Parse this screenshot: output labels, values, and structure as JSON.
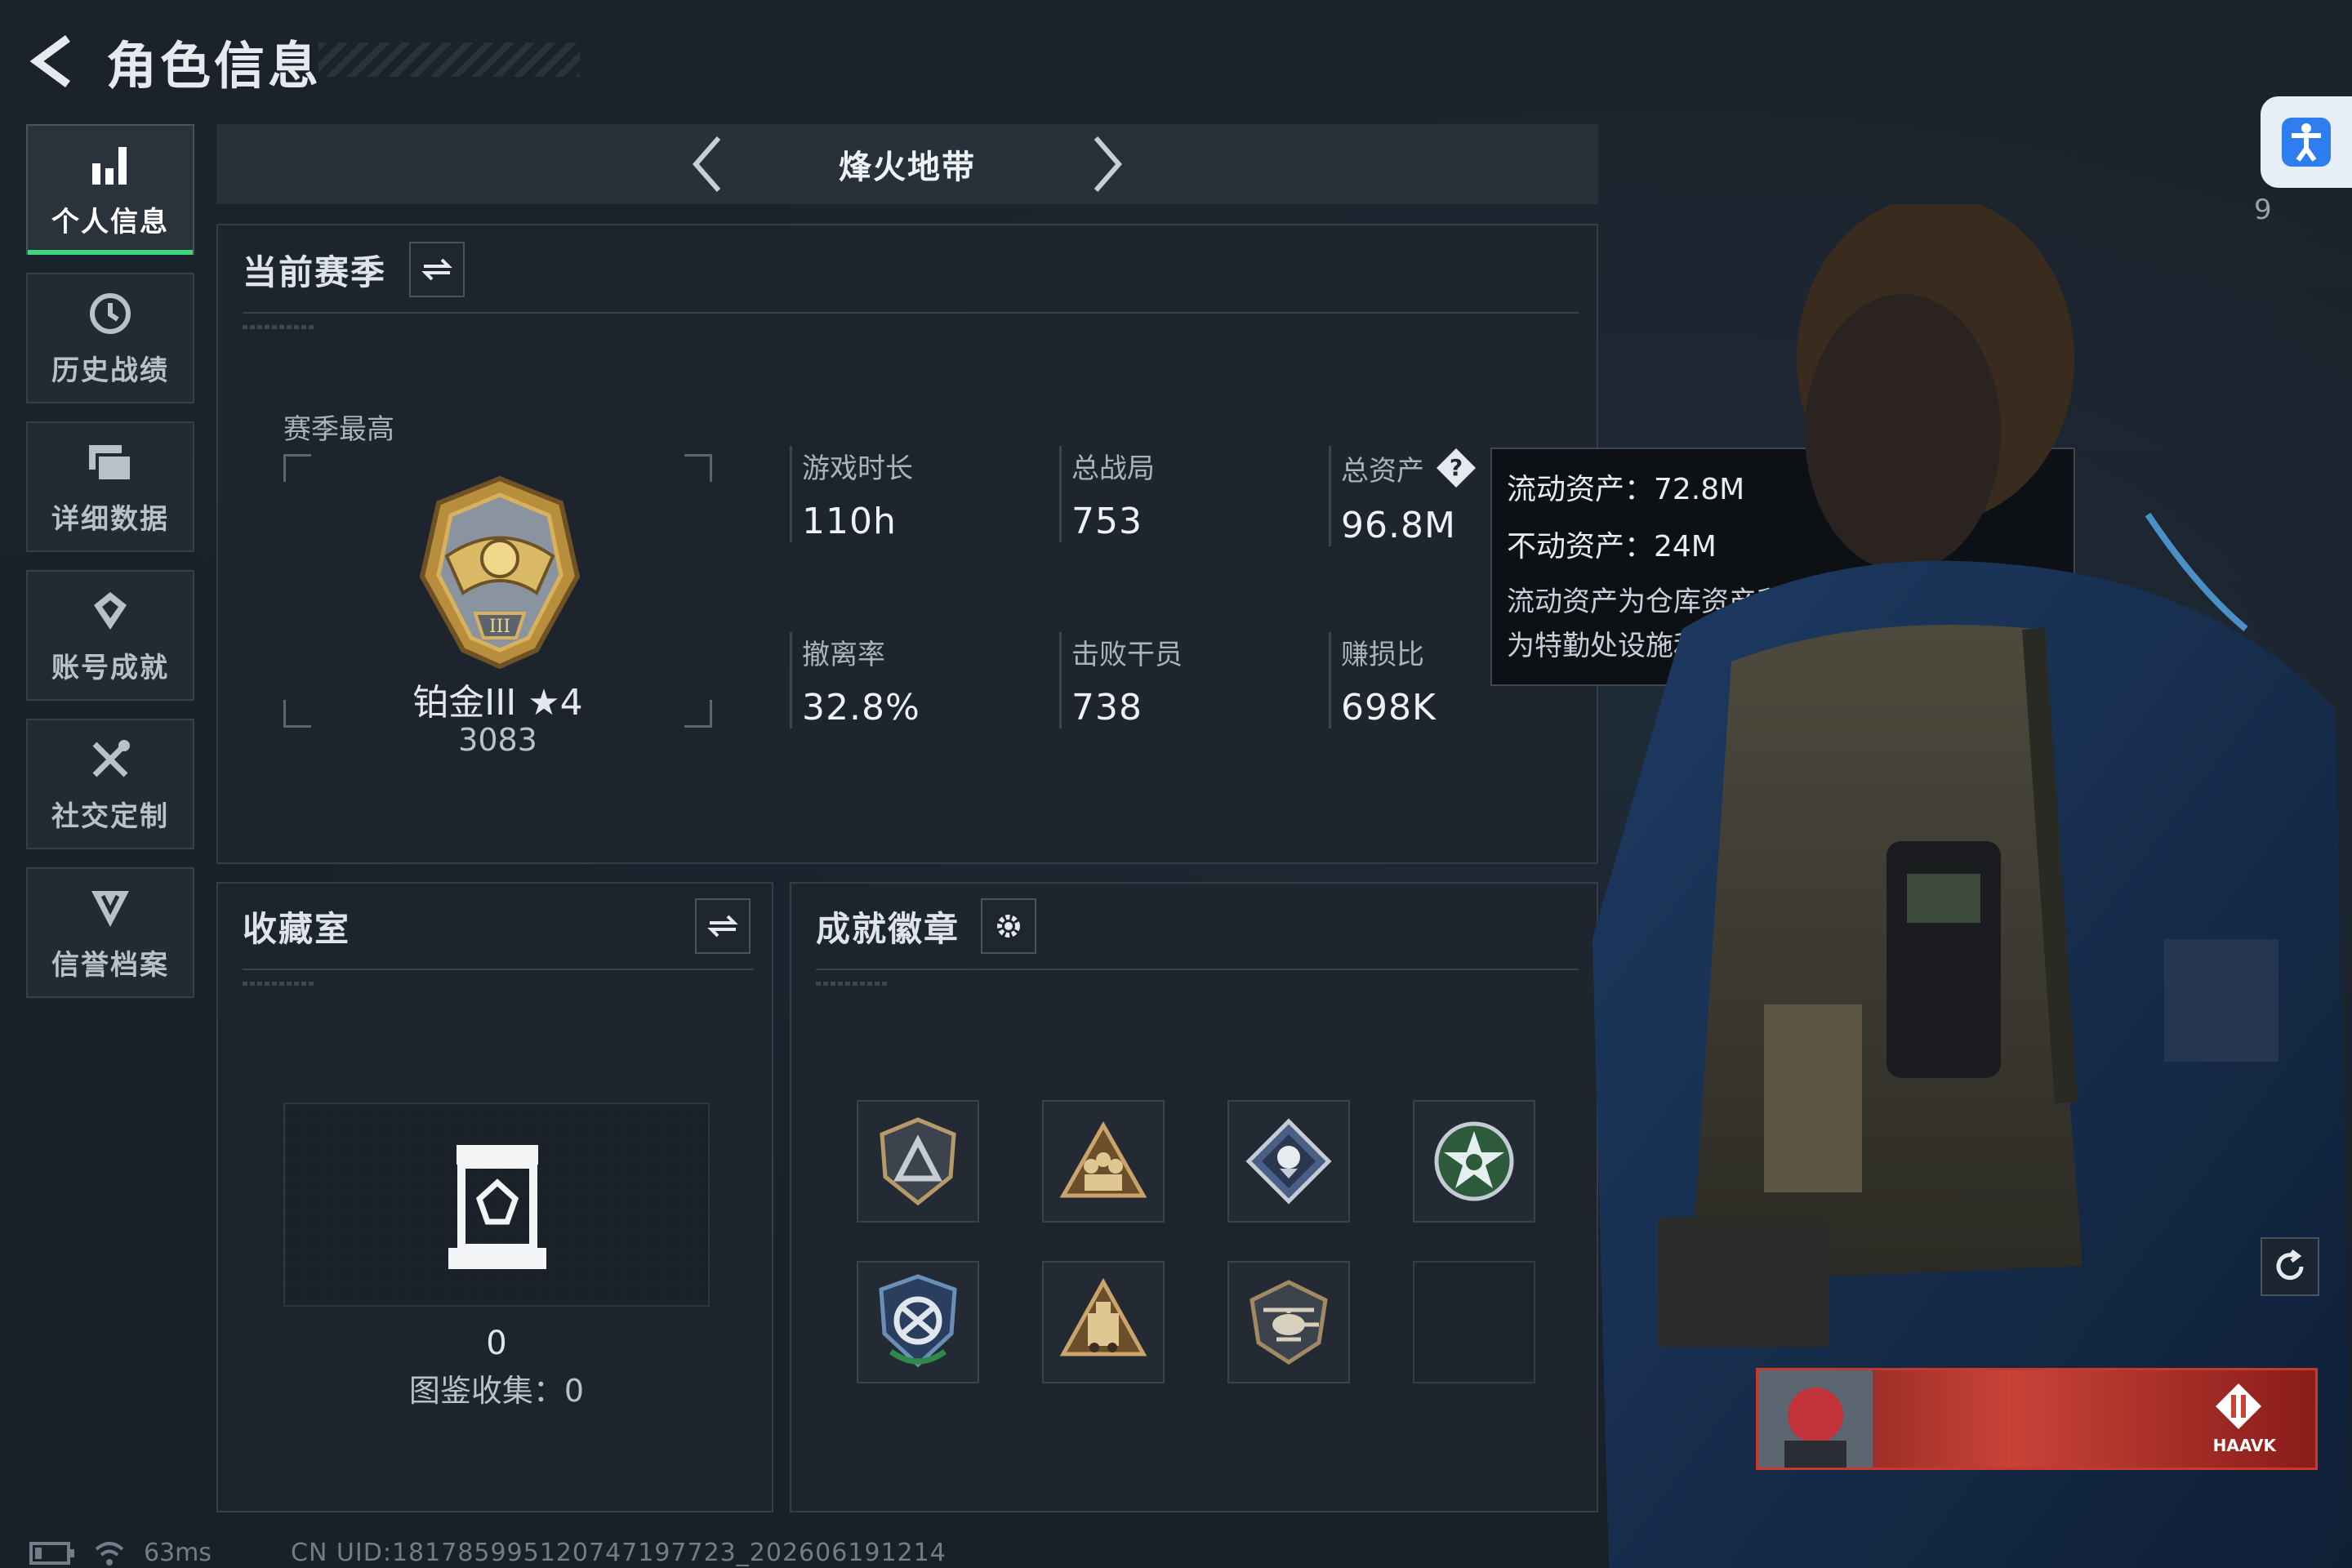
{
  "header": {
    "title": "角色信息"
  },
  "nav": {
    "items": [
      {
        "label": "个人信息"
      },
      {
        "label": "历史战绩"
      },
      {
        "label": "详细数据"
      },
      {
        "label": "账号成就"
      },
      {
        "label": "社交定制"
      },
      {
        "label": "信誉档案"
      }
    ]
  },
  "mode": {
    "title": "烽火地带"
  },
  "season": {
    "title": "当前赛季",
    "subtitle": "赛季最高",
    "rank_name": "铂金III ★4",
    "rank_score": "3083",
    "stats": [
      {
        "label": "游戏时长",
        "value": "110h"
      },
      {
        "label": "总战局",
        "value": "753"
      },
      {
        "label": "总资产",
        "value": "96.8M"
      },
      {
        "label": "撤离率",
        "value": "32.8%"
      },
      {
        "label": "击败干员",
        "value": "738"
      },
      {
        "label": "赚损比",
        "value": "698K"
      }
    ]
  },
  "tooltip": {
    "liquid": "流动资产：72.8M",
    "fixed": "不动资产：24M",
    "desc_line1": "流动资产为仓库资产和哈夫币，不动资产",
    "desc_line2": "为特勤处设施和收藏室设施"
  },
  "collection": {
    "title": "收藏室",
    "count": "0",
    "label": "图鉴收集：0"
  },
  "badges": {
    "title": "成就徽章",
    "items": [
      {
        "icon": "triangle-shield-badge-icon"
      },
      {
        "icon": "soldiers-badge-icon"
      },
      {
        "icon": "diamond-rose-badge-icon"
      },
      {
        "icon": "green-star-badge-icon"
      },
      {
        "icon": "arrows-shield-badge-icon"
      },
      {
        "icon": "vehicle-badge-icon"
      },
      {
        "icon": "helicopter-badge-icon"
      },
      {
        "icon": "empty-slot"
      }
    ]
  },
  "side": {
    "count": "9"
  },
  "card": {
    "brand": "HAAVK"
  },
  "status": {
    "ping": "63ms",
    "uid": "CN UID:18178599512074719772​3_202606191214"
  },
  "colors": {
    "background": "#1a2029",
    "panel": "#1e252e",
    "accent_green": "#3fd37a",
    "rank_gold": "#c9a24a",
    "card_red": "#c63a2e"
  }
}
